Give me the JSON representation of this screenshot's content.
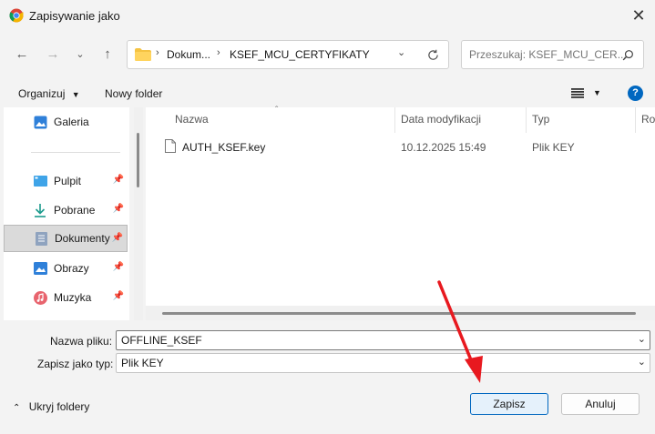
{
  "window": {
    "title": "Zapisywanie jako",
    "close": "✕"
  },
  "nav": {
    "breadcrumb": [
      "Dokum...",
      "KSEF_MCU_CERTYFIKATY"
    ],
    "search_placeholder": "Przeszukaj: KSEF_MCU_CER..."
  },
  "toolbar": {
    "organize": "Organizuj",
    "new_folder": "Nowy folder"
  },
  "sidebar": {
    "items": [
      {
        "label": "Galeria",
        "icon": "gallery-icon",
        "pinned": false,
        "selected": false
      },
      {
        "label": "Pulpit",
        "icon": "desktop-icon",
        "pinned": true,
        "selected": false
      },
      {
        "label": "Pobrane",
        "icon": "download-icon",
        "pinned": true,
        "selected": false
      },
      {
        "label": "Dokumenty",
        "icon": "documents-icon",
        "pinned": true,
        "selected": true
      },
      {
        "label": "Obrazy",
        "icon": "pictures-icon",
        "pinned": true,
        "selected": false
      },
      {
        "label": "Muzyka",
        "icon": "music-icon",
        "pinned": true,
        "selected": false
      }
    ]
  },
  "files": {
    "columns": [
      "Nazwa",
      "Data modyfikacji",
      "Typ",
      "Roz"
    ],
    "rows": [
      {
        "name": "AUTH_KSEF.key",
        "modified": "10.12.2025 15:49",
        "type": "Plik KEY"
      }
    ]
  },
  "form": {
    "filename_label": "Nazwa pliku:",
    "filename_value": "OFFLINE_KSEF",
    "type_label": "Zapisz jako typ:",
    "type_value": "Plik KEY"
  },
  "footer": {
    "hide_folders": "Ukryj foldery",
    "save": "Zapisz",
    "cancel": "Anuluj"
  },
  "colors": {
    "accent": "#0067c0",
    "arrow": "#e8191f"
  }
}
